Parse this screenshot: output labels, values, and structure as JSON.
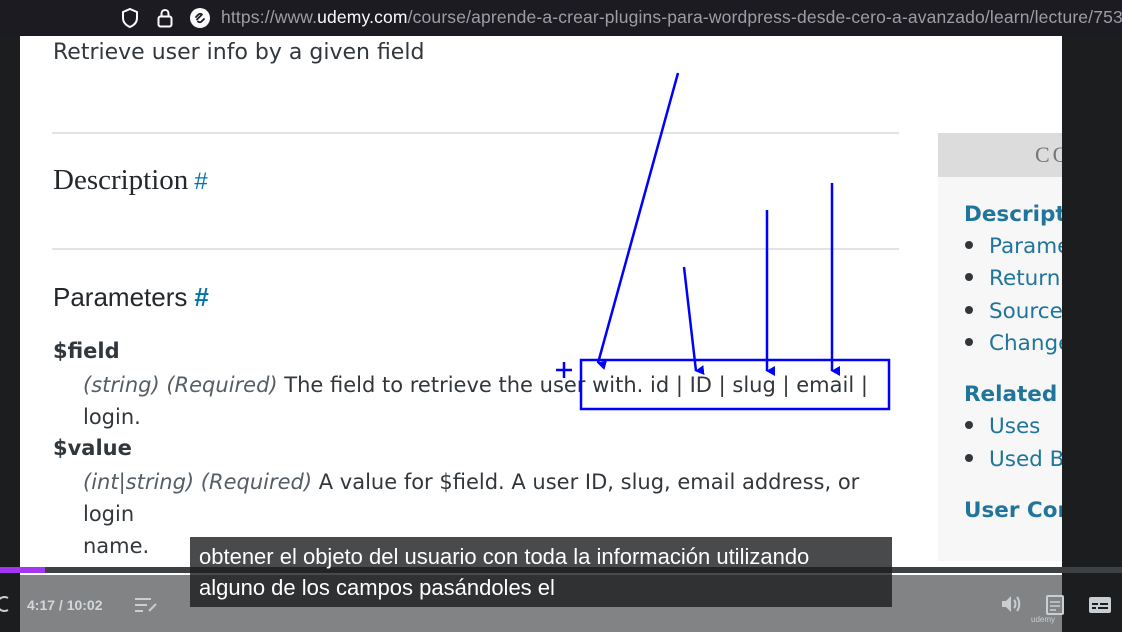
{
  "browser": {
    "url_prefix": "https://www.",
    "url_domain": "udemy.com",
    "url_path": "/course/aprende-a-crear-plugins-para-wordpress-desde-cero-a-avanzado/learn/lecture/75349"
  },
  "doc": {
    "lead": "Retrieve user info by a given field",
    "description_heading": "Description",
    "parameters_heading": "Parameters",
    "hash": "#",
    "params": [
      {
        "name": "$field",
        "type": "(string) (Required)",
        "desc_line1": " The field to retrieve the user with. id | ID | slug | email | login.",
        "desc_line2": ""
      },
      {
        "name": "$value",
        "type": "(int|string) (Required)",
        "desc_line1": " A value for $field. A user ID, slug, email address, or login",
        "desc_line2": "name."
      }
    ]
  },
  "sidebar": {
    "header": "CO",
    "description": "Descriptio",
    "toc": [
      "Parame",
      "Return",
      "Source",
      "Change"
    ],
    "related": "Related",
    "related_items": [
      "Uses",
      "Used By"
    ],
    "user_contrib": "User Cont"
  },
  "player": {
    "time": "4:17 / 10:02",
    "progress": 0.04,
    "caption_line1": "obtener el objeto del usuario con toda la información utilizando",
    "caption_line2": "alguno de los campos pasándoles el",
    "watermark": "udemy"
  },
  "colors": {
    "link": "#0073aa",
    "annotation": "#0000ff",
    "progress": "#a435f0"
  }
}
